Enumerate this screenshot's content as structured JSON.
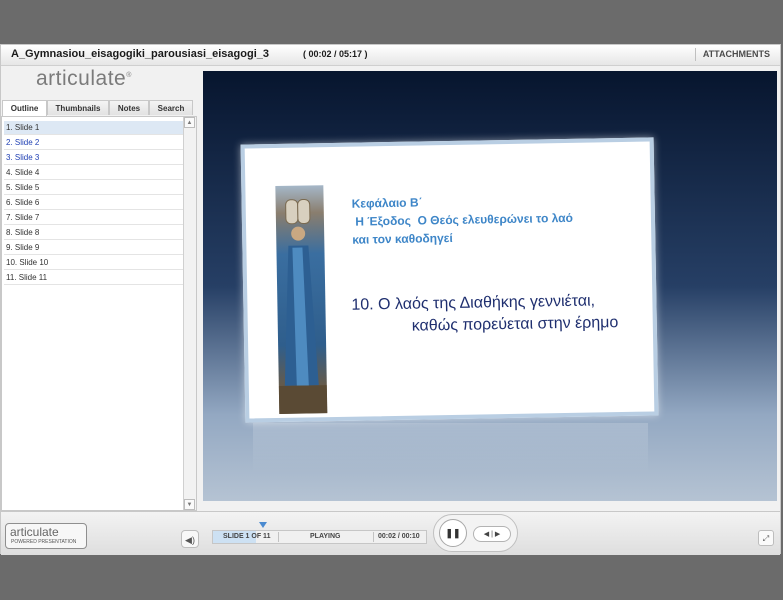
{
  "window": {
    "title": "A_Gymnasiou_eisagogiki_parousiasi_eisagogi_3",
    "time": "( 00:02 / 05:17 )",
    "attachments": "ATTACHMENTS"
  },
  "sidebar": {
    "logo": "articulate",
    "tabs": [
      "Outline",
      "Thumbnails",
      "Notes",
      "Search"
    ],
    "active_tab": "Outline",
    "items": [
      {
        "label": "1.  Slide 1",
        "state": "selected"
      },
      {
        "label": "2.  Slide 2",
        "state": "visited"
      },
      {
        "label": "3.  Slide 3",
        "state": "visited"
      },
      {
        "label": "4.  Slide 4",
        "state": "normal"
      },
      {
        "label": "5.  Slide 5",
        "state": "normal"
      },
      {
        "label": "6.  Slide 6",
        "state": "normal"
      },
      {
        "label": "7.  Slide 7",
        "state": "normal"
      },
      {
        "label": "8.  Slide 8",
        "state": "normal"
      },
      {
        "label": "9.  Slide 9",
        "state": "normal"
      },
      {
        "label": "10.  Slide 10",
        "state": "normal"
      },
      {
        "label": "11.  Slide 11",
        "state": "normal"
      }
    ]
  },
  "slide": {
    "heading_lines": [
      "Κεφάλαιο Β΄",
      " Η Έξοδος  Ο Θεός ελευθερώνει το λαό",
      "και τον καθοδηγεί"
    ],
    "body_lines": [
      "10. Ο λαός της Διαθήκης γεννιέται,",
      "καθώς πορεύεται στην έρημο"
    ]
  },
  "player": {
    "brand_main": "articulate",
    "brand_sub": "POWERED PRESENTATION",
    "slide_indicator": "SLIDE 1 OF 11",
    "status": "PLAYING",
    "slide_time": "00:02 / 00:10",
    "progress_fraction": 0.2
  },
  "icons": {
    "volume": "speaker-icon",
    "pause": "pause-icon",
    "prev_next": "prev-next-icon",
    "fullscreen": "fullscreen-icon"
  },
  "colors": {
    "heading": "#3e86c8",
    "body": "#1f2f6f",
    "visited_link": "#1f3fb3",
    "selected_row": "#dde8f4"
  }
}
